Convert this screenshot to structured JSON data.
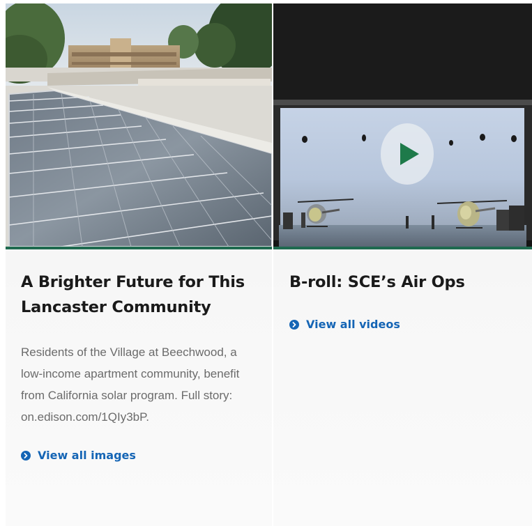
{
  "cards": [
    {
      "title": "A Brighter Future for This Lancaster Community",
      "description": "Residents of the Village at Beechwood, a low-income apartment community, benefit from California solar program. Full story: on.edison.com/1QIy3bP.",
      "link_label": "View all images",
      "link_icon": "chevron-right-circle-icon",
      "image_subject": "solar-panels-rooftop"
    },
    {
      "title": "B-roll: SCE’s Air Ops",
      "link_label": "View all videos",
      "link_icon": "chevron-right-circle-icon",
      "video_subject": "helicopter-hangar",
      "play_icon": "play-icon"
    }
  ],
  "colors": {
    "accent_bar": "#1f6a4f",
    "link": "#1565b5",
    "play_triangle": "#1e7a4a",
    "title": "#1a1a1a",
    "description": "#6b6b6b"
  }
}
